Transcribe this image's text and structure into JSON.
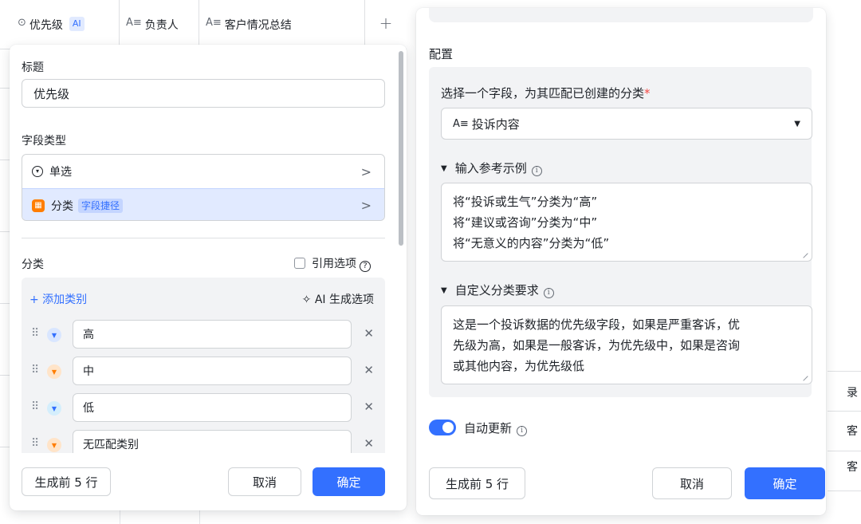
{
  "columns": {
    "priority": {
      "icon": "⊙",
      "label": "优先级",
      "ai_badge": "AI"
    },
    "owner": {
      "icon": "A≡",
      "label": "负责人"
    },
    "summary": {
      "icon": "A≡",
      "label": "客户情况总结"
    },
    "add": "+"
  },
  "left_panel": {
    "title_label": "标题",
    "title_value": "优先级",
    "field_type_label": "字段类型",
    "type_options": [
      {
        "icon": "single-select-icon",
        "label": "单选",
        "chevron": ">"
      },
      {
        "icon": "category-icon",
        "label": "分类",
        "badge": "字段捷径",
        "chevron": ">"
      }
    ],
    "category_label": "分类",
    "reference_option_label": "引用选项",
    "add_category": "+ 添加类别",
    "ai_generate": "AI 生成选项",
    "categories": [
      {
        "value": "高",
        "color": "#3370ff",
        "bg": "#d9e6ff"
      },
      {
        "value": "中",
        "color": "#ff7d00",
        "bg": "#ffe4c9"
      },
      {
        "value": "低",
        "color": "#3370ff",
        "bg": "#d4eefc"
      },
      {
        "value": "无匹配类别",
        "color": "#ff7d00",
        "bg": "#ffe4c9"
      }
    ],
    "generate_first": "生成前 5 行",
    "cancel": "取消",
    "confirm": "确定"
  },
  "right_panel": {
    "config_label": "配置",
    "field_select_label": "选择一个字段，为其匹配已创建的分类",
    "required_mark": "*",
    "field_select_icon": "A≡",
    "field_select_value": "投诉内容",
    "examples_label": "输入参考示例",
    "examples_lines": [
      "将“投诉或生气”分类为“高”",
      "将“建议或咨询”分类为“中”",
      "将“无意义的内容”分类为“低”"
    ],
    "custom_label": "自定义分类要求",
    "custom_lines": [
      "这是一个投诉数据的优先级字段，如果是严重客诉，优",
      "先级为高，如果是一般客诉，为优先级中，如果是咨询",
      "或其他内容，为优先级低"
    ],
    "auto_update_label": "自动更新",
    "auto_update_on": true,
    "generate_first": "生成前 5 行",
    "cancel": "取消",
    "confirm": "确定"
  },
  "background_clipped": [
    "录",
    "客",
    "客"
  ],
  "colors": {
    "accent": "#3370ff",
    "required": "#f54a45"
  }
}
